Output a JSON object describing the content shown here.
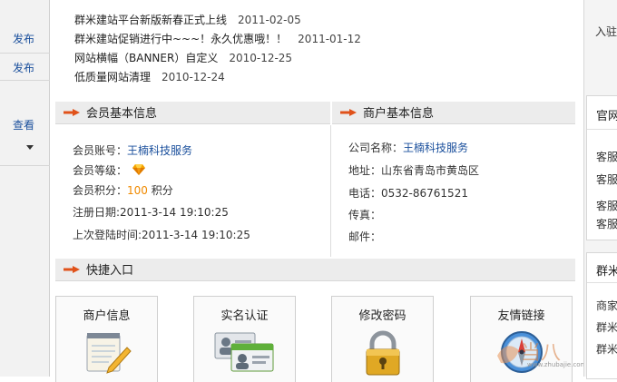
{
  "sidebar": {
    "links": [
      "发布",
      "发布",
      "查看"
    ]
  },
  "news": [
    {
      "title": "群米建站平台新版新春正式上线",
      "date": "2011-02-05"
    },
    {
      "title": "群米建站促销进行中~~~！永久优惠哦！！",
      "date": "2011-01-12"
    },
    {
      "title": "网站横幅（BANNER）自定义",
      "date": "2010-12-25"
    },
    {
      "title": "低质量网站清理",
      "date": "2010-12-24"
    }
  ],
  "member": {
    "header": "会员基本信息",
    "account_label": "会员账号：",
    "account_value": "王楠科技服务",
    "level_label": "会员等级：",
    "points_label": "会员积分：",
    "points_value": "100",
    "points_unit": " 积分",
    "reg_label": "注册日期:",
    "reg_value": "2011-3-14 19:10:25",
    "last_login_label": "上次登陆时间:",
    "last_login_value": "2011-3-14 19:10:25"
  },
  "merchant": {
    "header": "商户基本信息",
    "company_label": "公司名称：",
    "company_value": "王楠科技服务",
    "address_label": "地址：",
    "address_value": "山东省青岛市黄岛区",
    "phone_label": "电话：",
    "phone_value": "0532-86761521",
    "fax_label": "传真：",
    "fax_value": "",
    "email_label": "邮件：",
    "email_value": ""
  },
  "quick": {
    "header": "快捷入口",
    "cards": [
      "商户信息",
      "实名认证",
      "修改密码",
      "友情链接"
    ]
  },
  "right": {
    "top_text": "入驻",
    "box1_title": "官网",
    "box1_items": [
      "客服",
      "客服",
      "客服",
      "客服"
    ],
    "box2_title": "群米",
    "box2_items": [
      "商家",
      "群米",
      "群米"
    ]
  },
  "watermark": {
    "site": "www.zhubajie.com"
  },
  "colors": {
    "link": "#1a4f9c",
    "accent_arrow": "#e0521a",
    "points": "#f08a00",
    "header_bg": "#ececec"
  }
}
